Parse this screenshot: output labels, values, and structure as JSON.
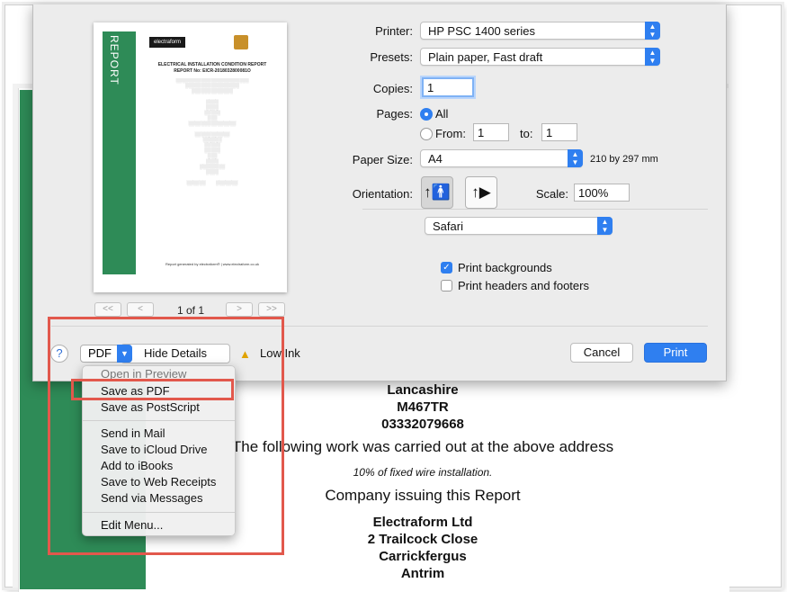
{
  "document": {
    "lines": [
      {
        "text": "Lancashire",
        "style": "bold"
      },
      {
        "text": "M467TR",
        "style": "bold"
      },
      {
        "text": "03332079668",
        "style": "bold"
      },
      {
        "text": "The following work was carried out at the above address",
        "style": "big"
      },
      {
        "text": "10% of fixed wire installation.",
        "style": "small"
      },
      {
        "text": "Company issuing this Report",
        "style": "big"
      },
      {
        "text": "Electraform Ltd",
        "style": "bold"
      },
      {
        "text": "2 Trailcock Close",
        "style": "bold"
      },
      {
        "text": "Carrickfergus",
        "style": "bold"
      },
      {
        "text": "Antrim",
        "style": "bold"
      }
    ]
  },
  "preview": {
    "vertical_label": "REPORT",
    "logo_text": "electraform",
    "title": "ELECTRICAL INSTALLATION CONDITION REPORT",
    "report_no": "REPORT No: EICR-2018032800081O",
    "footer": "Report generated by electraform® | www.electraform.co.uk",
    "page_count": "1 of 1",
    "pager_first": "<<",
    "pager_prev": "<",
    "pager_next": ">",
    "pager_last": ">>"
  },
  "print_sheet": {
    "printer_label": "Printer:",
    "printer_value": "HP PSC 1400 series",
    "presets_label": "Presets:",
    "presets_value": "Plain paper, Fast draft",
    "copies_label": "Copies:",
    "copies_value": "1",
    "pages_label": "Pages:",
    "pages_all": "All",
    "pages_from": "From:",
    "pages_from_value": "1",
    "pages_to": "to:",
    "pages_to_value": "1",
    "paper_size_label": "Paper Size:",
    "paper_size_value": "A4",
    "paper_dims": "210 by 297 mm",
    "orientation_label": "Orientation:",
    "scale_label": "Scale:",
    "scale_value": "100%",
    "app_section": "Safari",
    "print_backgrounds": "Print backgrounds",
    "print_headers": "Print headers and footers",
    "help_label": "?",
    "pdf_label": "PDF",
    "hide_details": "Hide Details",
    "low_ink": "Low Ink",
    "cancel": "Cancel",
    "print": "Print"
  },
  "pdf_menu": {
    "items": [
      "Open in Preview",
      "Save as PDF",
      "Save as PostScript",
      "Send in Mail",
      "Save to iCloud Drive",
      "Add to iBooks",
      "Save to Web Receipts",
      "Send via Messages",
      "Edit Menu..."
    ]
  },
  "colors": {
    "accent": "#2f7ff0",
    "brand_green": "#2e8b57",
    "annotation_red": "#e2584c"
  }
}
